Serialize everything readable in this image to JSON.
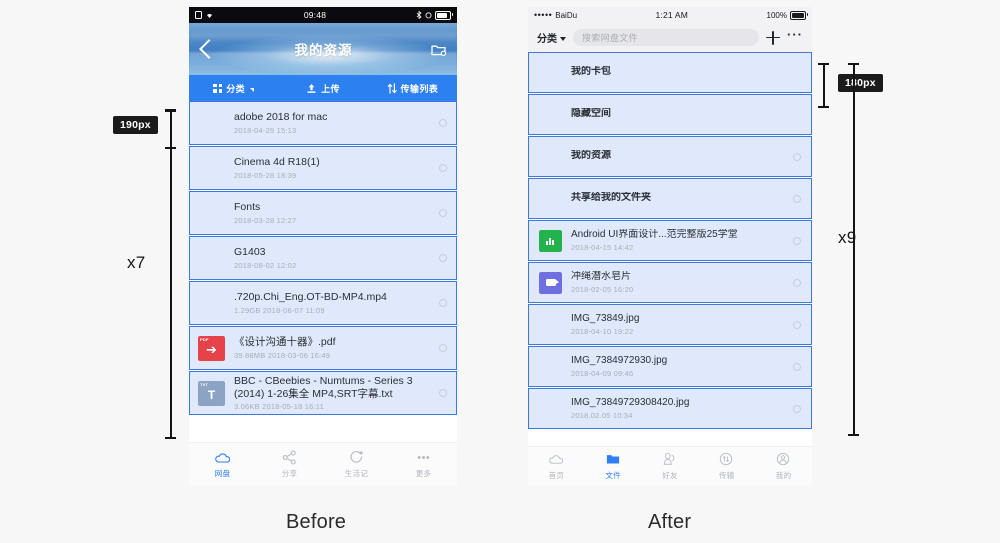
{
  "page": {
    "background": "#f7f7f7",
    "before_caption": "Before",
    "after_caption": "After"
  },
  "annotations": {
    "left_row_height_badge": "190px",
    "left_visible_count": "x7",
    "right_row_height_badge": "180px",
    "right_visible_count": "x9"
  },
  "left_phone": {
    "status_bar": {
      "time": "09:48"
    },
    "header": {
      "title": "我的资源",
      "back_icon": "chevron-left-icon",
      "action_icon": "new-folder-icon"
    },
    "toolbar": [
      {
        "label": "分类",
        "icon": "grid-icon",
        "has_caret": true
      },
      {
        "label": "上传",
        "icon": "upload-icon",
        "has_caret": false
      },
      {
        "label": "传输列表",
        "icon": "transfer-icon",
        "has_caret": false
      }
    ],
    "rows": [
      {
        "name": "adobe 2018 for mac",
        "sub": "2018-04-25  15:13",
        "icon": "folder",
        "two_line": false
      },
      {
        "name": "Cinema 4d R18(1)",
        "sub": "2018-05-28  18:39",
        "icon": "folder",
        "two_line": false
      },
      {
        "name": "Fonts",
        "sub": "2018-03-28  12:27",
        "icon": "folder",
        "two_line": false
      },
      {
        "name": "G1403",
        "sub": "2018-08-02  12:02",
        "icon": "folder",
        "two_line": false
      },
      {
        "name": ".720p.Chi_Eng.OT-BD-MP4.mp4",
        "sub": "1.29GB  2018-06-07  11:09",
        "icon": "photo-face",
        "two_line": false
      },
      {
        "name": "《设计沟通十器》.pdf",
        "sub": "39.88MB  2018-03-06  16:49",
        "icon": "pdf",
        "two_line": false
      },
      {
        "name": "BBC - CBeebies - Numtums - Series 3 (2014) 1-26集全 MP4,SRT字幕.txt",
        "sub": "3.06KB  2018-05-18  16:11",
        "icon": "txt",
        "two_line": true
      }
    ],
    "tabbar": [
      {
        "label": "网盘",
        "icon": "cloud-icon",
        "active": true
      },
      {
        "label": "分享",
        "icon": "share-icon",
        "active": false
      },
      {
        "label": "生活记",
        "icon": "circle-dot-icon",
        "active": false
      },
      {
        "label": "更多",
        "icon": "more-dots-icon",
        "active": false
      }
    ]
  },
  "right_phone": {
    "status_bar": {
      "carrier": "BaiDu",
      "signal_dots": "•••••",
      "time": "1:21 AM",
      "battery": "100%"
    },
    "toolbar": {
      "category_label": "分类",
      "search_placeholder": "搜索网盘文件",
      "add_icon": "plus-icon",
      "more_icon": "more-dots-icon"
    },
    "rows": [
      {
        "name": "我的卡包",
        "sub": "",
        "icon": "folder",
        "radio": false
      },
      {
        "name": "隐藏空间",
        "sub": "",
        "icon": "folder",
        "radio": false
      },
      {
        "name": "我的资源",
        "sub": "",
        "icon": "folder",
        "radio": true
      },
      {
        "name": "共享给我的文件夹",
        "sub": "",
        "icon": "folder",
        "radio": true
      },
      {
        "name": "Android UI界面设计...范完整版25学堂",
        "sub": "2018-04-15   14:42",
        "icon": "xls",
        "radio": true
      },
      {
        "name": "冲绳潜水皂片",
        "sub": "2018-02-05   16:20",
        "icon": "video",
        "radio": true
      },
      {
        "name": "IMG_73849.jpg",
        "sub": "2018-04-10   19:22",
        "icon": "photo-portrait",
        "radio": true
      },
      {
        "name": "IMG_7384972930.jpg",
        "sub": "2018-04-09   09:46",
        "icon": "photo-sunset",
        "radio": true
      },
      {
        "name": "IMG_73849729308420.jpg",
        "sub": "2018.02.05   10:34",
        "icon": "photo-crowd",
        "radio": true
      }
    ],
    "tabbar": [
      {
        "label": "首页",
        "icon": "cloud-icon",
        "active": false
      },
      {
        "label": "文件",
        "icon": "folder-icon",
        "active": true
      },
      {
        "label": "好友",
        "icon": "friends-icon",
        "active": false
      },
      {
        "label": "传输",
        "icon": "transfer-icon",
        "active": false
      },
      {
        "label": "我的",
        "icon": "user-icon",
        "active": false
      }
    ]
  }
}
